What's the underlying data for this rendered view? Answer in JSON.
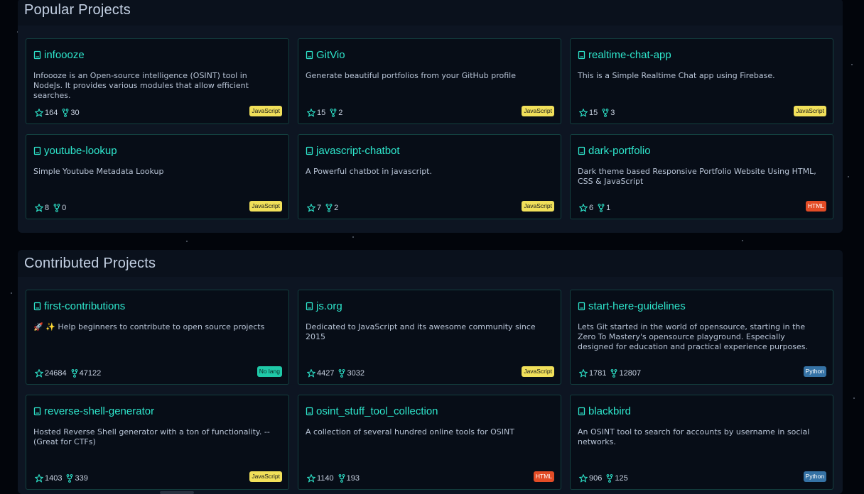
{
  "colors": {
    "accent": "#2ee6cc",
    "card_border": "#13403f",
    "javascript": "#f1e05a",
    "html": "#e34c26",
    "python": "#3572a5",
    "no_lang": "#1fc9a8"
  },
  "popular": {
    "title": "Popular Projects",
    "cards": [
      {
        "name": "infoooze",
        "desc": "Infoooze is an Open-source intelligence (OSINT) tool in NodeJs. It provides various modules that allow efficient searches.",
        "stars": "164",
        "forks": "30",
        "lang": "JavaScript"
      },
      {
        "name": "GitVio",
        "desc": "Generate beautiful portfolios from your GitHub profile",
        "stars": "15",
        "forks": "2",
        "lang": "JavaScript"
      },
      {
        "name": "realtime-chat-app",
        "desc": "This is a Simple Realtime Chat app using Firebase.",
        "stars": "15",
        "forks": "3",
        "lang": "JavaScript"
      },
      {
        "name": "youtube-lookup",
        "desc": "Simple Youtube Metadata Lookup",
        "stars": "8",
        "forks": "0",
        "lang": "JavaScript"
      },
      {
        "name": "javascript-chatbot",
        "desc": "A Powerful chatbot in javascript.",
        "stars": "7",
        "forks": "2",
        "lang": "JavaScript"
      },
      {
        "name": "dark-portfolio",
        "desc": "Dark theme based Responsive Portfolio Website Using HTML, CSS & JavaScript",
        "stars": "6",
        "forks": "1",
        "lang": "HTML"
      }
    ]
  },
  "contributed": {
    "title": "Contributed Projects",
    "cards": [
      {
        "name": "first-contributions",
        "desc": "🚀 ✨ Help beginners to contribute to open source projects",
        "stars": "24684",
        "forks": "47122",
        "lang": "No lang"
      },
      {
        "name": "js.org",
        "desc": "Dedicated to JavaScript and its awesome community since 2015",
        "stars": "4427",
        "forks": "3032",
        "lang": "JavaScript"
      },
      {
        "name": "start-here-guidelines",
        "desc": "Lets Git started in the world of opensource, starting in the Zero To Mastery's opensource playground. Especially designed for education and practical experience purposes.",
        "stars": "1781",
        "forks": "12807",
        "lang": "Python"
      },
      {
        "name": "reverse-shell-generator",
        "desc": "Hosted Reverse Shell generator with a ton of functionality. -- (Great for CTFs)",
        "stars": "1403",
        "forks": "339",
        "lang": "JavaScript"
      },
      {
        "name": "osint_stuff_tool_collection",
        "desc": "A collection of several hundred online tools for OSINT",
        "stars": "1140",
        "forks": "193",
        "lang": "HTML"
      },
      {
        "name": "blackbird",
        "desc": "An OSINT tool to search for accounts by username in social networks.",
        "stars": "906",
        "forks": "125",
        "lang": "Python"
      }
    ]
  }
}
